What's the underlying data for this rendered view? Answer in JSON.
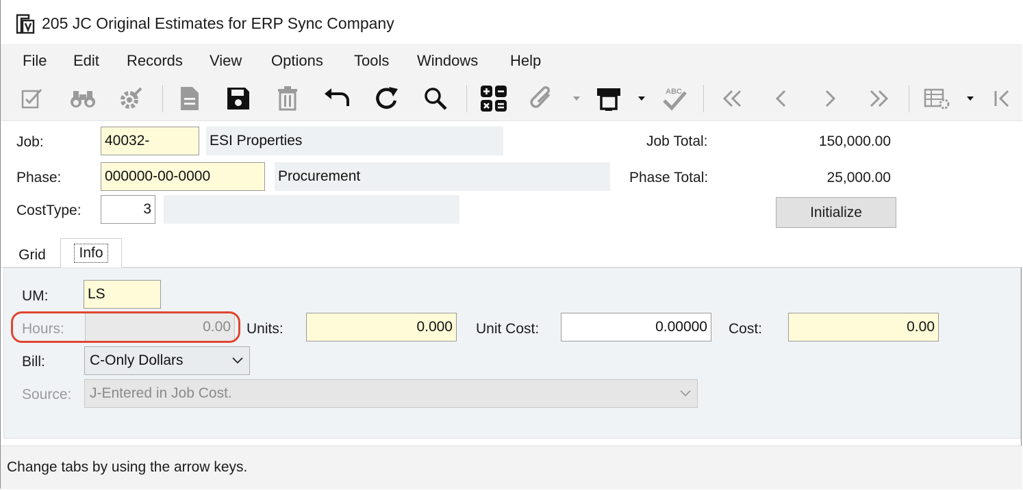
{
  "window": {
    "title": "205 JC Original Estimates for ERP Sync Company",
    "app_icon": "viewpoint-form-icon"
  },
  "menu": [
    "File",
    "Edit",
    "Records",
    "View",
    "Options",
    "Tools",
    "Windows",
    "Help"
  ],
  "toolbar": {
    "icons": [
      "checklist-icon",
      "binoculars-icon",
      "settings-icon",
      "new-document-icon",
      "save-icon",
      "delete-icon",
      "undo-icon",
      "refresh-icon",
      "search-icon",
      "calculator-icon",
      "attachment-icon",
      "print-icon",
      "spellcheck-icon",
      "first-record-icon",
      "previous-record-icon",
      "next-record-icon",
      "last-record-icon",
      "grid-settings-icon",
      "collapse-icon"
    ]
  },
  "header": {
    "job_label": "Job:",
    "job_value": "40032-",
    "job_desc": "ESI Properties",
    "phase_label": "Phase:",
    "phase_value": "000000-00-0000",
    "phase_desc": "Procurement",
    "costtype_label": "CostType:",
    "costtype_value": "3",
    "costtype_desc": "",
    "job_total_label": "Job Total:",
    "job_total_value": "150,000.00",
    "phase_total_label": "Phase Total:",
    "phase_total_value": "25,000.00",
    "initialize_label": "Initialize"
  },
  "tabs": [
    {
      "label": "Grid",
      "active": false
    },
    {
      "label": "Info",
      "active": true
    }
  ],
  "info": {
    "um_label": "UM:",
    "um_value": "LS",
    "hours_label": "Hours:",
    "hours_value": "0.00",
    "units_label": "Units:",
    "units_value": "0.000",
    "unit_cost_label": "Unit Cost:",
    "unit_cost_value": "0.00000",
    "cost_label": "Cost:",
    "cost_value": "0.00",
    "bill_label": "Bill:",
    "bill_value": "C-Only Dollars",
    "source_label": "Source:",
    "source_value": "J-Entered in Job Cost."
  },
  "colors": {
    "required_field": "#fffbd8",
    "highlight": "#e0452f",
    "panel": "#f0f3f6"
  },
  "status": {
    "text": "Change tabs by using the arrow keys."
  }
}
